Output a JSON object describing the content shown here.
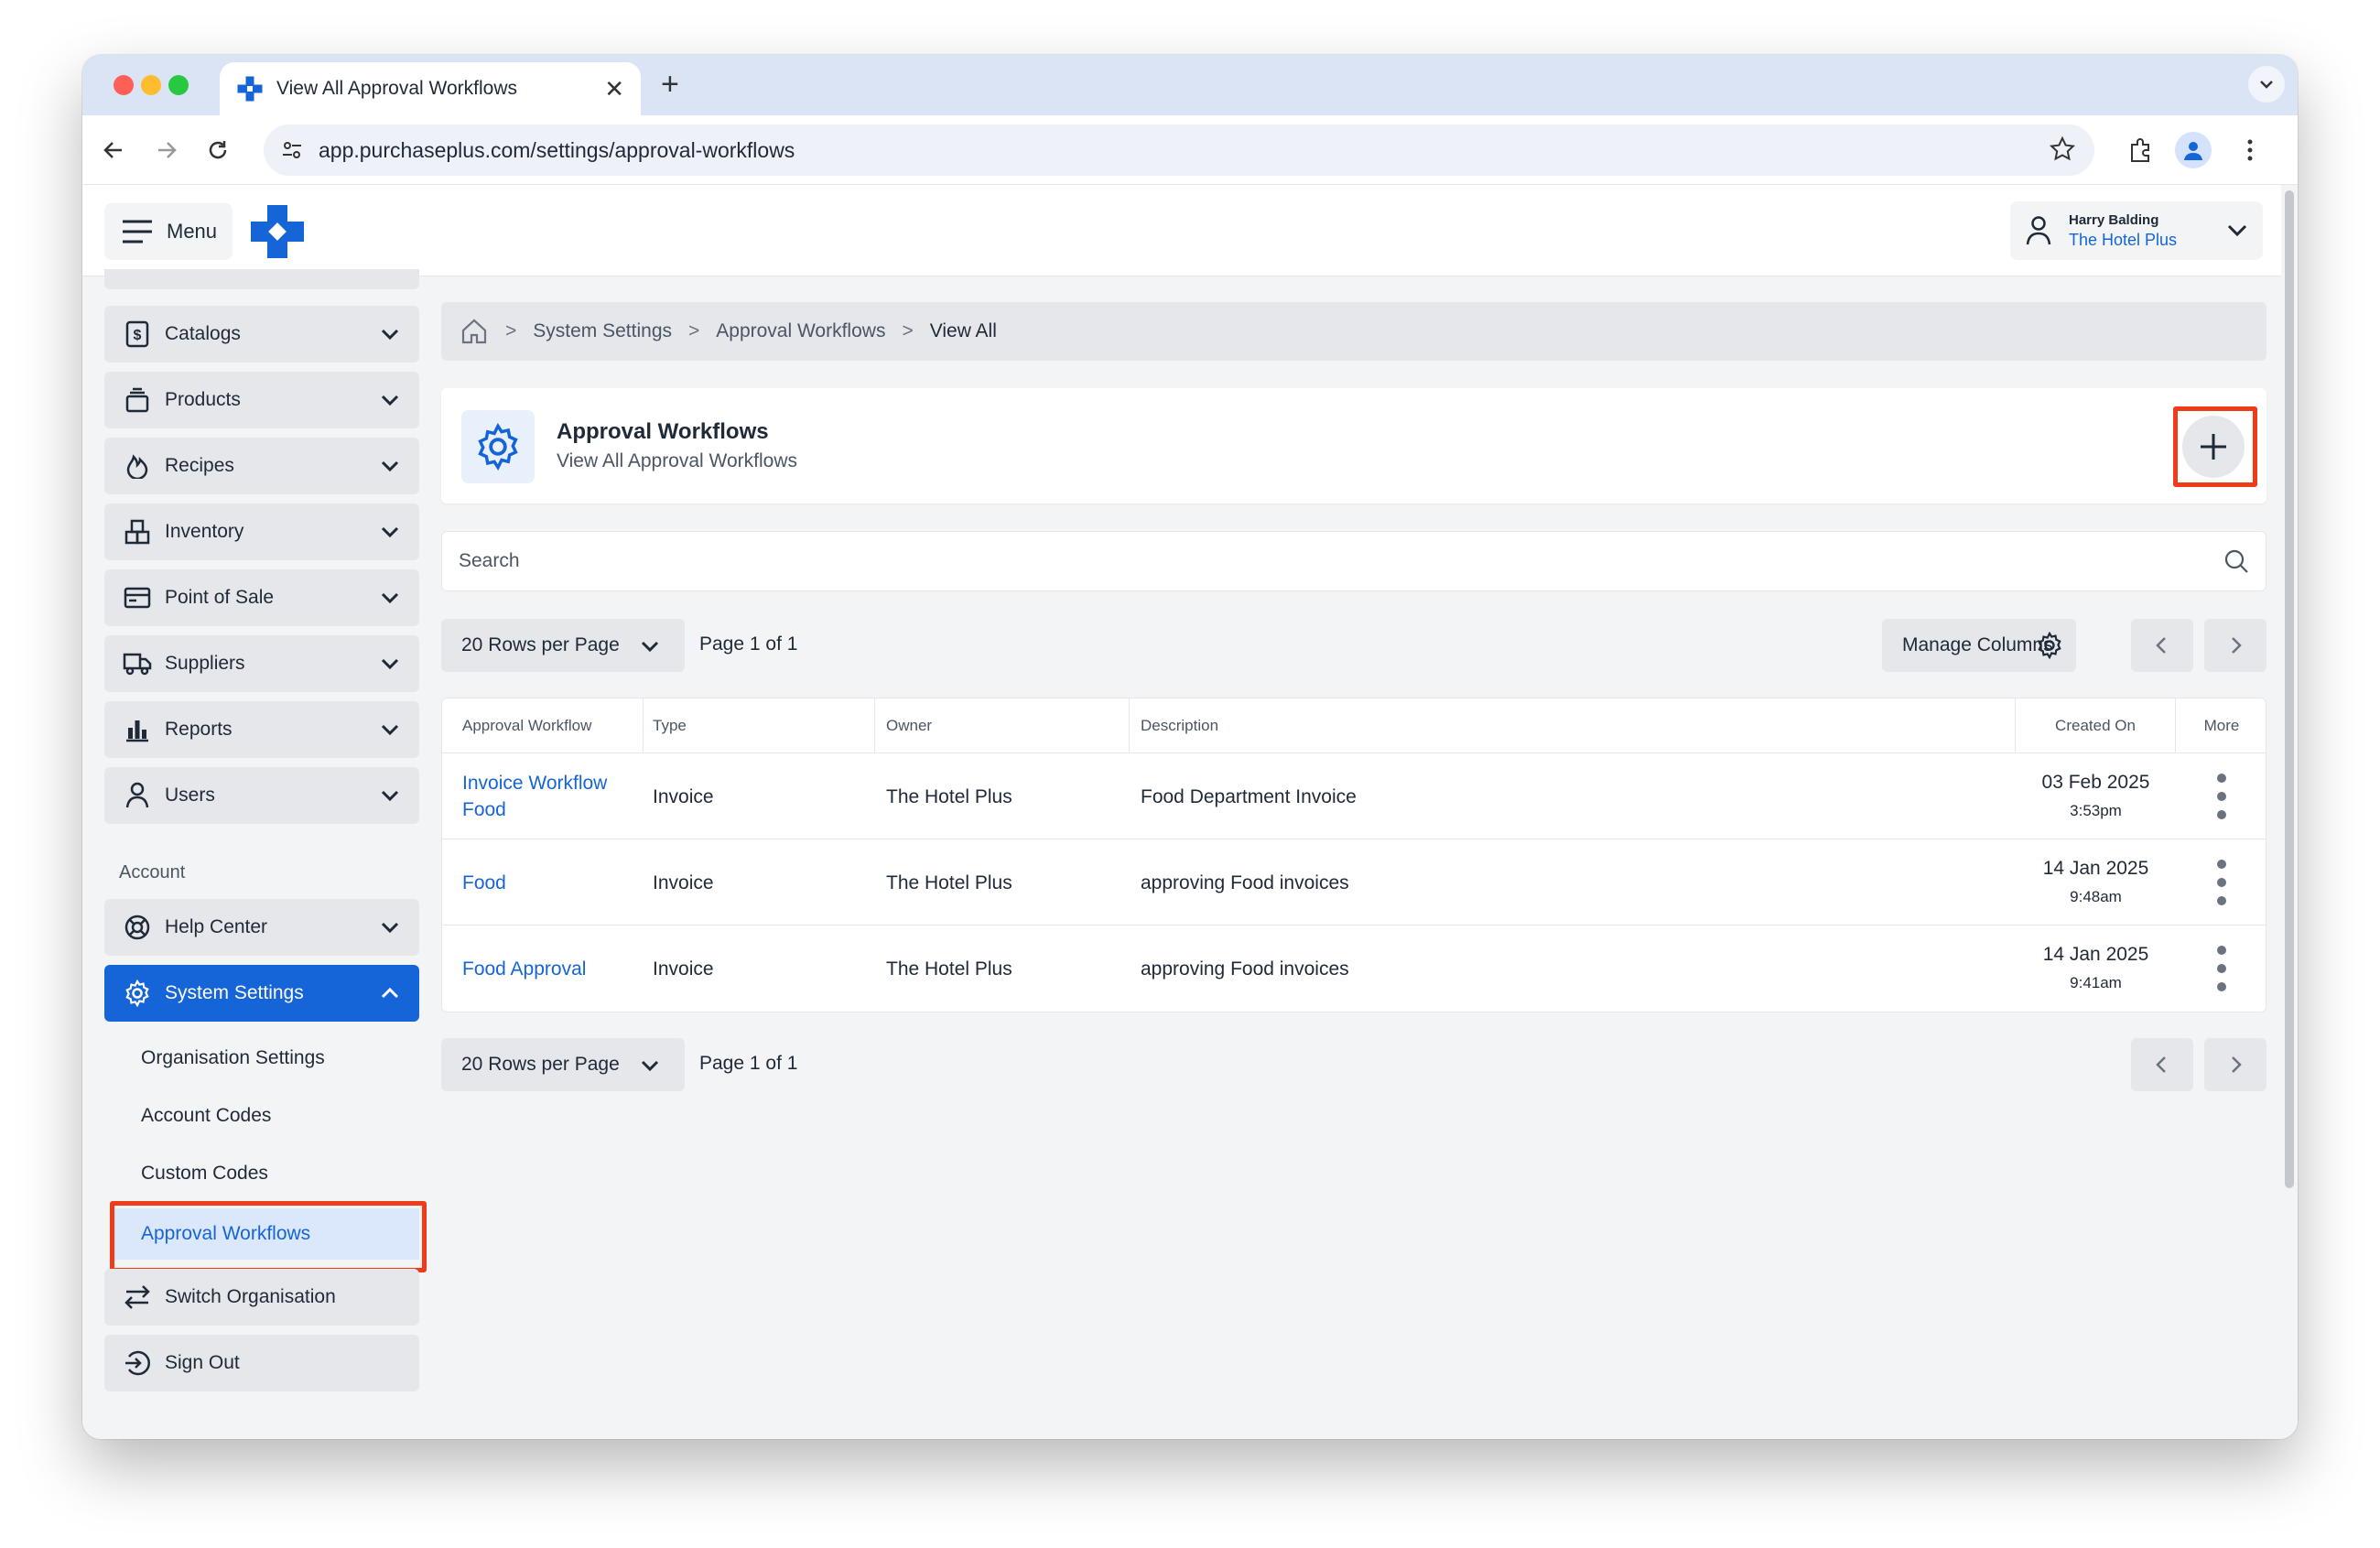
{
  "browser": {
    "tab_title": "View All Approval Workflows",
    "url": "app.purchaseplus.com/settings/approval-workflows"
  },
  "header": {
    "menu_label": "Menu",
    "user_name": "Harry Balding",
    "user_org": "The Hotel Plus"
  },
  "sidebar": {
    "items": [
      {
        "label": "Catalogs",
        "icon": "dollar-doc-icon"
      },
      {
        "label": "Products",
        "icon": "box-icon"
      },
      {
        "label": "Recipes",
        "icon": "flame-icon"
      },
      {
        "label": "Inventory",
        "icon": "blocks-icon"
      },
      {
        "label": "Point of Sale",
        "icon": "card-icon"
      },
      {
        "label": "Suppliers",
        "icon": "truck-icon"
      },
      {
        "label": "Reports",
        "icon": "chart-icon"
      },
      {
        "label": "Users",
        "icon": "user-icon"
      }
    ],
    "account_label": "Account",
    "help_center": "Help Center",
    "system_settings": "System Settings",
    "sub_items": [
      "Organisation Settings",
      "Account Codes",
      "Custom Codes",
      "Approval Workflows"
    ],
    "switch_org": "Switch Organisation",
    "sign_out": "Sign Out"
  },
  "breadcrumb": [
    "System Settings",
    "Approval Workflows",
    "View All"
  ],
  "page": {
    "title": "Approval Workflows",
    "subtitle": "View All Approval Workflows"
  },
  "search": {
    "placeholder": "Search"
  },
  "pager": {
    "rows_label": "20 Rows per Page",
    "page_label": "Page 1 of 1",
    "manage_columns": "Manage Columns"
  },
  "table": {
    "headers": [
      "Approval Workflow",
      "Type",
      "Owner",
      "Description",
      "Created On",
      "More"
    ],
    "rows": [
      {
        "name": "Invoice Workflow Food",
        "type": "Invoice",
        "owner": "The Hotel Plus",
        "description": "Food Department Invoice",
        "date": "03 Feb 2025",
        "time": "3:53pm"
      },
      {
        "name": "Food",
        "type": "Invoice",
        "owner": "The Hotel Plus",
        "description": "approving Food invoices",
        "date": "14 Jan 2025",
        "time": "9:48am"
      },
      {
        "name": "Food Approval",
        "type": "Invoice",
        "owner": "The Hotel Plus",
        "description": "approving Food invoices",
        "date": "14 Jan 2025",
        "time": "9:41am"
      }
    ]
  },
  "colors": {
    "accent": "#1565d8",
    "highlight": "#ef3b1a"
  }
}
